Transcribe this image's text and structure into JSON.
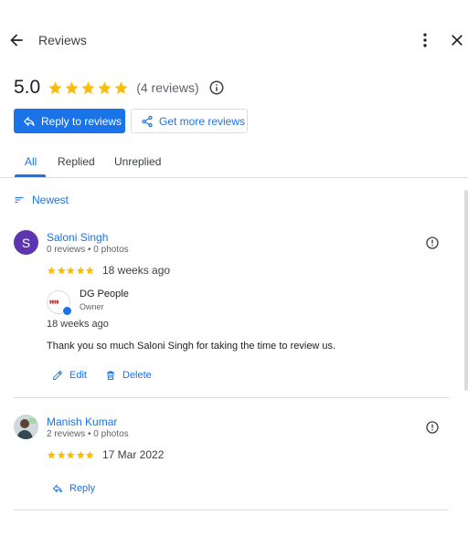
{
  "header": {
    "title": "Reviews",
    "back_icon": "arrow-left-icon",
    "more_icon": "more-vert-icon",
    "close_icon": "close-icon"
  },
  "summary": {
    "rating": "5.0",
    "stars": 5,
    "review_count": "(4 reviews)",
    "star_color": "#fbbc04"
  },
  "actions": {
    "reply_to_reviews": "Reply to reviews",
    "get_more_reviews": "Get more reviews",
    "primary_color": "#1a73e8"
  },
  "tabs": [
    {
      "label": "All",
      "active": true
    },
    {
      "label": "Replied",
      "active": false
    },
    {
      "label": "Unreplied",
      "active": false
    }
  ],
  "sort": {
    "label": "Newest"
  },
  "reviews": [
    {
      "avatar_letter": "S",
      "name": "Saloni Singh",
      "meta": "0 reviews • 0 photos",
      "stars": 5,
      "date": "18 weeks ago",
      "owner_reply": {
        "owner_name": "DG People",
        "owner_role": "Owner",
        "date": "18 weeks ago",
        "text": "Thank you so much Saloni Singh for taking the time to review us.",
        "edit_label": "Edit",
        "delete_label": "Delete"
      }
    },
    {
      "name": "Manish Kumar",
      "meta": "2 reviews • 0 photos",
      "stars": 5,
      "date": "17 Mar 2022",
      "reply_label": "Reply"
    }
  ]
}
